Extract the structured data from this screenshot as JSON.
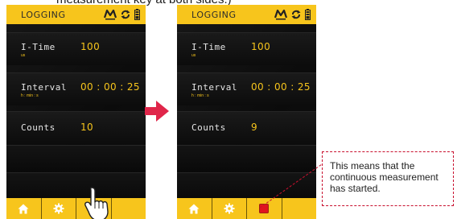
{
  "caption": "measurement key at both sides.)",
  "colors": {
    "accent": "#f7c51c",
    "screen_bg": "#000000",
    "stop_red": "#e0141e",
    "callout_border": "#c8102e",
    "arrow": "#e0264a"
  },
  "screens": [
    {
      "title": "LOGGING",
      "status_icons": [
        "mode-icon",
        "repeat-icon",
        "battery-icon"
      ],
      "rows": [
        {
          "label": "I-Time",
          "unit": "us",
          "value": "100"
        },
        {
          "label": "Interval",
          "unit": "h : min : s",
          "value": "00 : 00 : 25"
        },
        {
          "label": "Counts",
          "unit": "",
          "value": "10"
        }
      ],
      "bottom_buttons": [
        "home-icon",
        "settings-gear-icon",
        "measure-icon"
      ]
    },
    {
      "title": "LOGGING",
      "status_icons": [
        "mode-icon",
        "repeat-icon",
        "battery-icon"
      ],
      "rows": [
        {
          "label": "I-Time",
          "unit": "us",
          "value": "100"
        },
        {
          "label": "Interval",
          "unit": "h : min : s",
          "value": "00 : 00 : 25"
        },
        {
          "label": "Counts",
          "unit": "",
          "value": "9"
        }
      ],
      "bottom_buttons": [
        "home-icon",
        "settings-gear-icon",
        "stop-square-icon"
      ]
    }
  ],
  "callout": {
    "text": "This means that the continuous measurement has started."
  }
}
